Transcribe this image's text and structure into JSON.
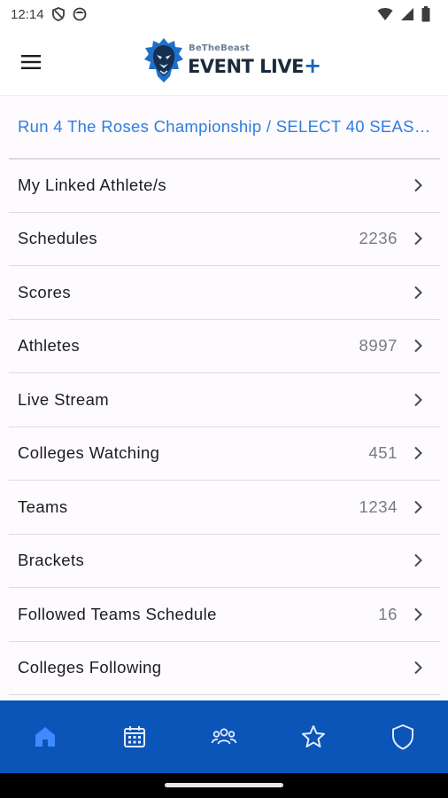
{
  "status_bar": {
    "time": "12:14",
    "left_icons": [
      "vpn-shield-icon",
      "face-icon"
    ],
    "right_icons": [
      "wifi-icon",
      "signal-icon",
      "battery-icon"
    ]
  },
  "app_bar": {
    "menu_icon": "hamburger-menu-icon",
    "logo": {
      "small_text": "BeTheBeast",
      "main_text": "EVENT LIVE",
      "plus": "+",
      "icon": "lion-head-icon"
    }
  },
  "event": {
    "title": "Run 4 The Roses Championship / SELECT 40 SEASON"
  },
  "menu": {
    "items": [
      {
        "label": "My Linked Athlete/s",
        "count": ""
      },
      {
        "label": "Schedules",
        "count": "2236"
      },
      {
        "label": "Scores",
        "count": ""
      },
      {
        "label": "Athletes",
        "count": "8997"
      },
      {
        "label": "Live Stream",
        "count": ""
      },
      {
        "label": "Colleges Watching",
        "count": "451"
      },
      {
        "label": "Teams",
        "count": "1234"
      },
      {
        "label": "Brackets",
        "count": ""
      },
      {
        "label": "Followed Teams Schedule",
        "count": "16"
      },
      {
        "label": "Colleges Following",
        "count": ""
      }
    ]
  },
  "bottom_nav": {
    "items": [
      "home-icon",
      "calendar-icon",
      "people-icon",
      "star-icon",
      "shield-icon"
    ],
    "active_index": 0
  },
  "colors": {
    "accent": "#2f7de1",
    "nav_bar": "#0b54b8",
    "nav_active": "#3d8bff",
    "nav_inactive": "#e3ecf9"
  }
}
